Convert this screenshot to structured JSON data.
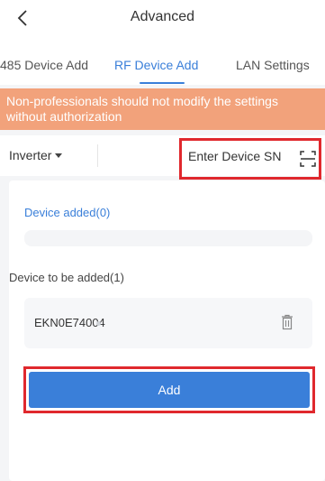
{
  "header": {
    "title": "Advanced",
    "back_icon": "chevron-left-icon"
  },
  "tabs": [
    {
      "label": "485 Device Add",
      "active": false
    },
    {
      "label": "RF Device Add",
      "active": true
    },
    {
      "label": "LAN Settings",
      "active": false
    }
  ],
  "warning": {
    "text": "Non-professionals should not modify the settings without authorization"
  },
  "device_bar": {
    "type_value": "Inverter",
    "sn_placeholder": "Enter Device SN",
    "scan_icon": "scan-icon"
  },
  "added": {
    "label": "Device added(0)"
  },
  "to_be_added": {
    "label": "Device to be added(1)",
    "items": [
      {
        "sn": "EKN0E74004",
        "icon": "trash-icon"
      }
    ]
  },
  "actions": {
    "add_label": "Add"
  },
  "colors": {
    "accent": "#3a7fd9",
    "warning": "#f2a27b",
    "highlight": "#e0282d"
  }
}
